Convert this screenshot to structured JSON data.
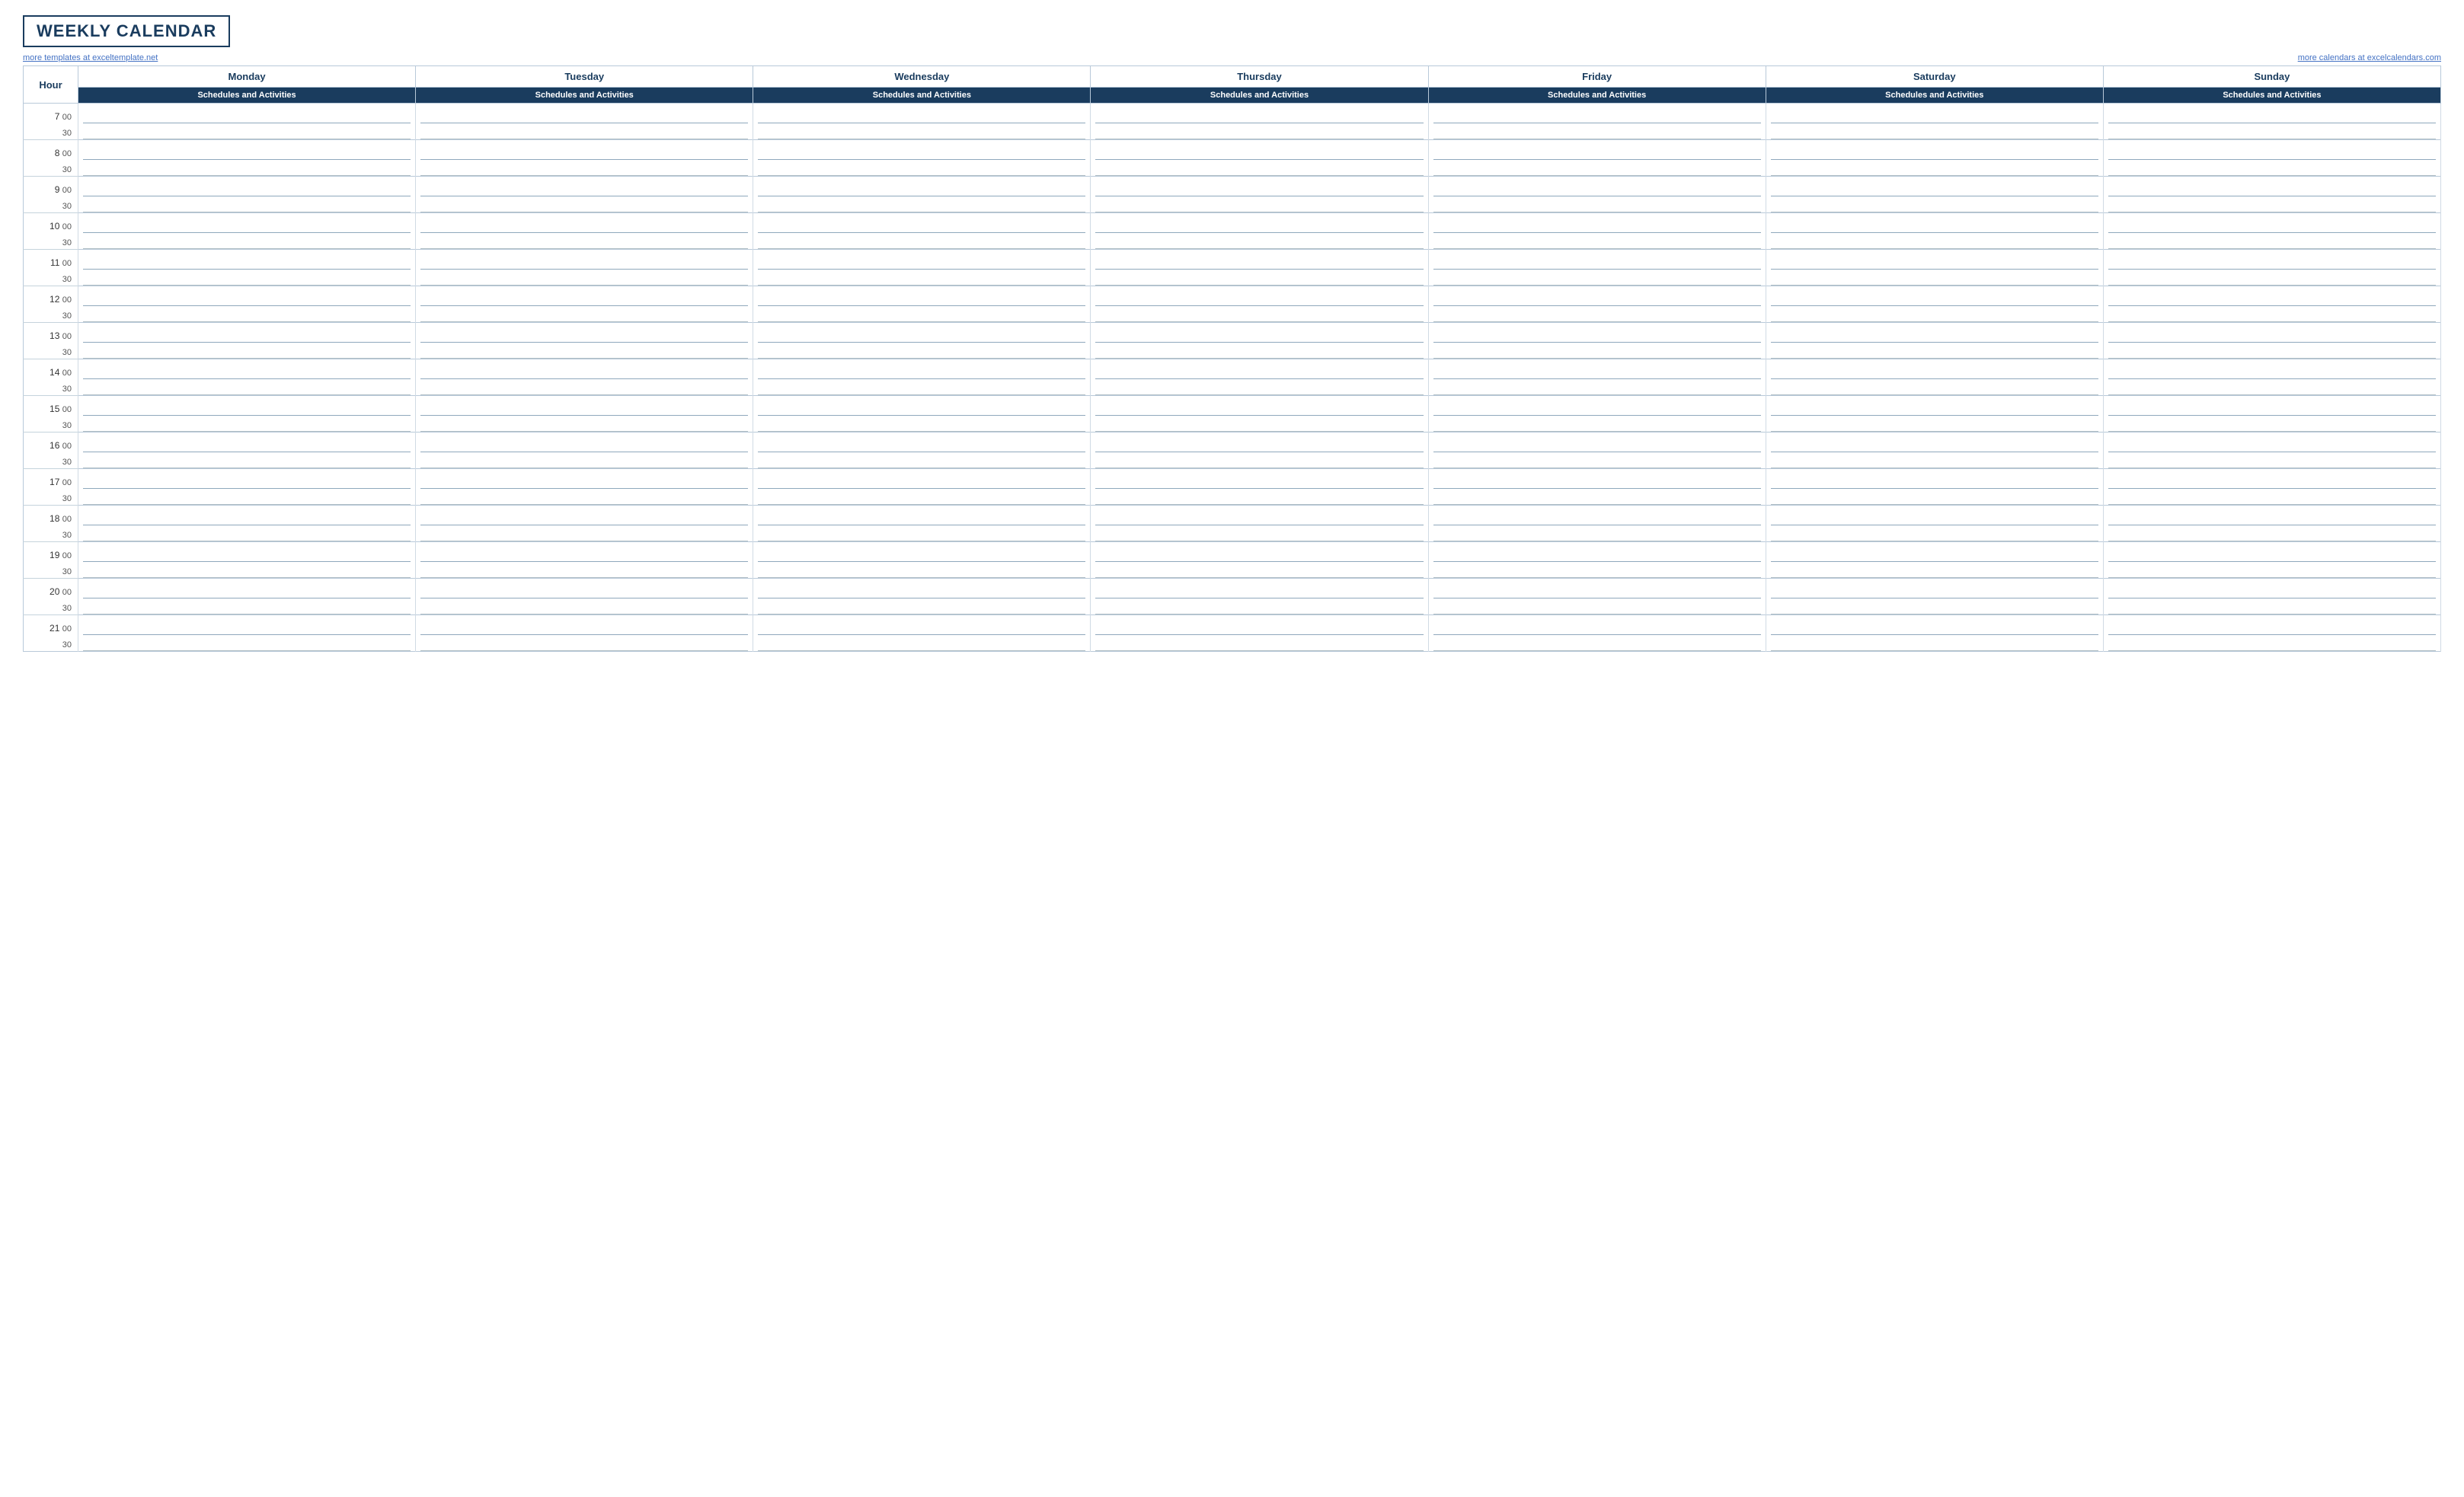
{
  "header": {
    "title": "WEEKLY CALENDAR",
    "link_left": "more templates at exceltemplate.net",
    "link_right": "more calendars at excelcalendars.com"
  },
  "columns": {
    "hour_label": "Hour",
    "days": [
      "Monday",
      "Tuesday",
      "Wednesday",
      "Thursday",
      "Friday",
      "Saturday",
      "Sunday"
    ],
    "sub_label": "Schedules and Activities"
  },
  "time_slots": [
    {
      "hour": "7",
      "minute": "00"
    },
    {
      "hour": "",
      "minute": "30"
    },
    {
      "hour": "8",
      "minute": "00"
    },
    {
      "hour": "",
      "minute": "30"
    },
    {
      "hour": "9",
      "minute": "00"
    },
    {
      "hour": "",
      "minute": "30"
    },
    {
      "hour": "10",
      "minute": "00"
    },
    {
      "hour": "",
      "minute": "30"
    },
    {
      "hour": "11",
      "minute": "00"
    },
    {
      "hour": "",
      "minute": "30"
    },
    {
      "hour": "12",
      "minute": "00"
    },
    {
      "hour": "",
      "minute": "30"
    },
    {
      "hour": "13",
      "minute": "00"
    },
    {
      "hour": "",
      "minute": "30"
    },
    {
      "hour": "14",
      "minute": "00"
    },
    {
      "hour": "",
      "minute": "30"
    },
    {
      "hour": "15",
      "minute": "00"
    },
    {
      "hour": "",
      "minute": "30"
    },
    {
      "hour": "16",
      "minute": "00"
    },
    {
      "hour": "",
      "minute": "30"
    },
    {
      "hour": "17",
      "minute": "00"
    },
    {
      "hour": "",
      "minute": "30"
    },
    {
      "hour": "18",
      "minute": "00"
    },
    {
      "hour": "",
      "minute": "30"
    },
    {
      "hour": "19",
      "minute": "00"
    },
    {
      "hour": "",
      "minute": "30"
    },
    {
      "hour": "20",
      "minute": "00"
    },
    {
      "hour": "",
      "minute": "30"
    },
    {
      "hour": "21",
      "minute": "00"
    },
    {
      "hour": "",
      "minute": "30"
    }
  ]
}
